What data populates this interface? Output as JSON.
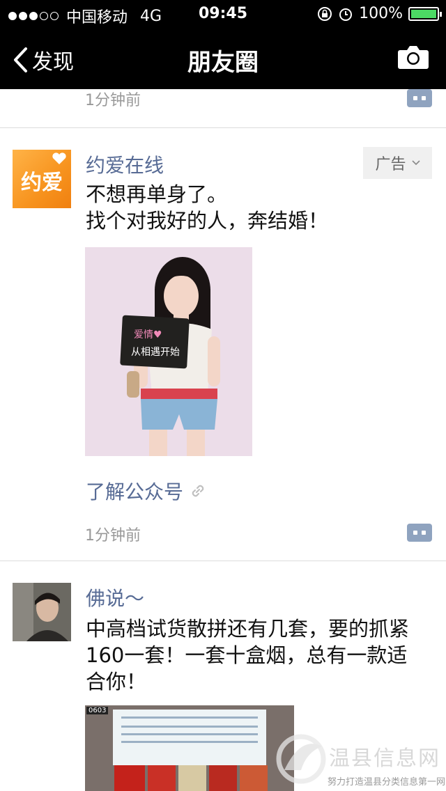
{
  "status_bar": {
    "carrier": "中国移动",
    "network": "4G",
    "time": "09:45",
    "battery": "100%"
  },
  "nav": {
    "back_label": "发现",
    "title": "朋友圈"
  },
  "feed": {
    "prev_post_time": "1分钟前",
    "posts": [
      {
        "author": "约爱在线",
        "avatar_text": "约爱",
        "badge": "广告",
        "text_lines": [
          "不想再单身了。",
          "找个对我好的人，奔结婚！"
        ],
        "image_sign_line1": "爱情♥",
        "image_sign_line2": "从相遇开始",
        "link_label": "了解公众号",
        "time": "1分钟前"
      },
      {
        "author": "佛说～",
        "text_lines": [
          "中高档试货散拼还有几套，要的抓紧",
          "160一套！一套十盒烟，总有一款适",
          "合你！"
        ],
        "image_tag": "0603"
      }
    ]
  },
  "watermark": {
    "title": "温县信息网",
    "subtitle": "努力打造温县分类信息第一网"
  },
  "colors": {
    "link_blue": "#576b95",
    "ad_orange": "#f7931e"
  }
}
